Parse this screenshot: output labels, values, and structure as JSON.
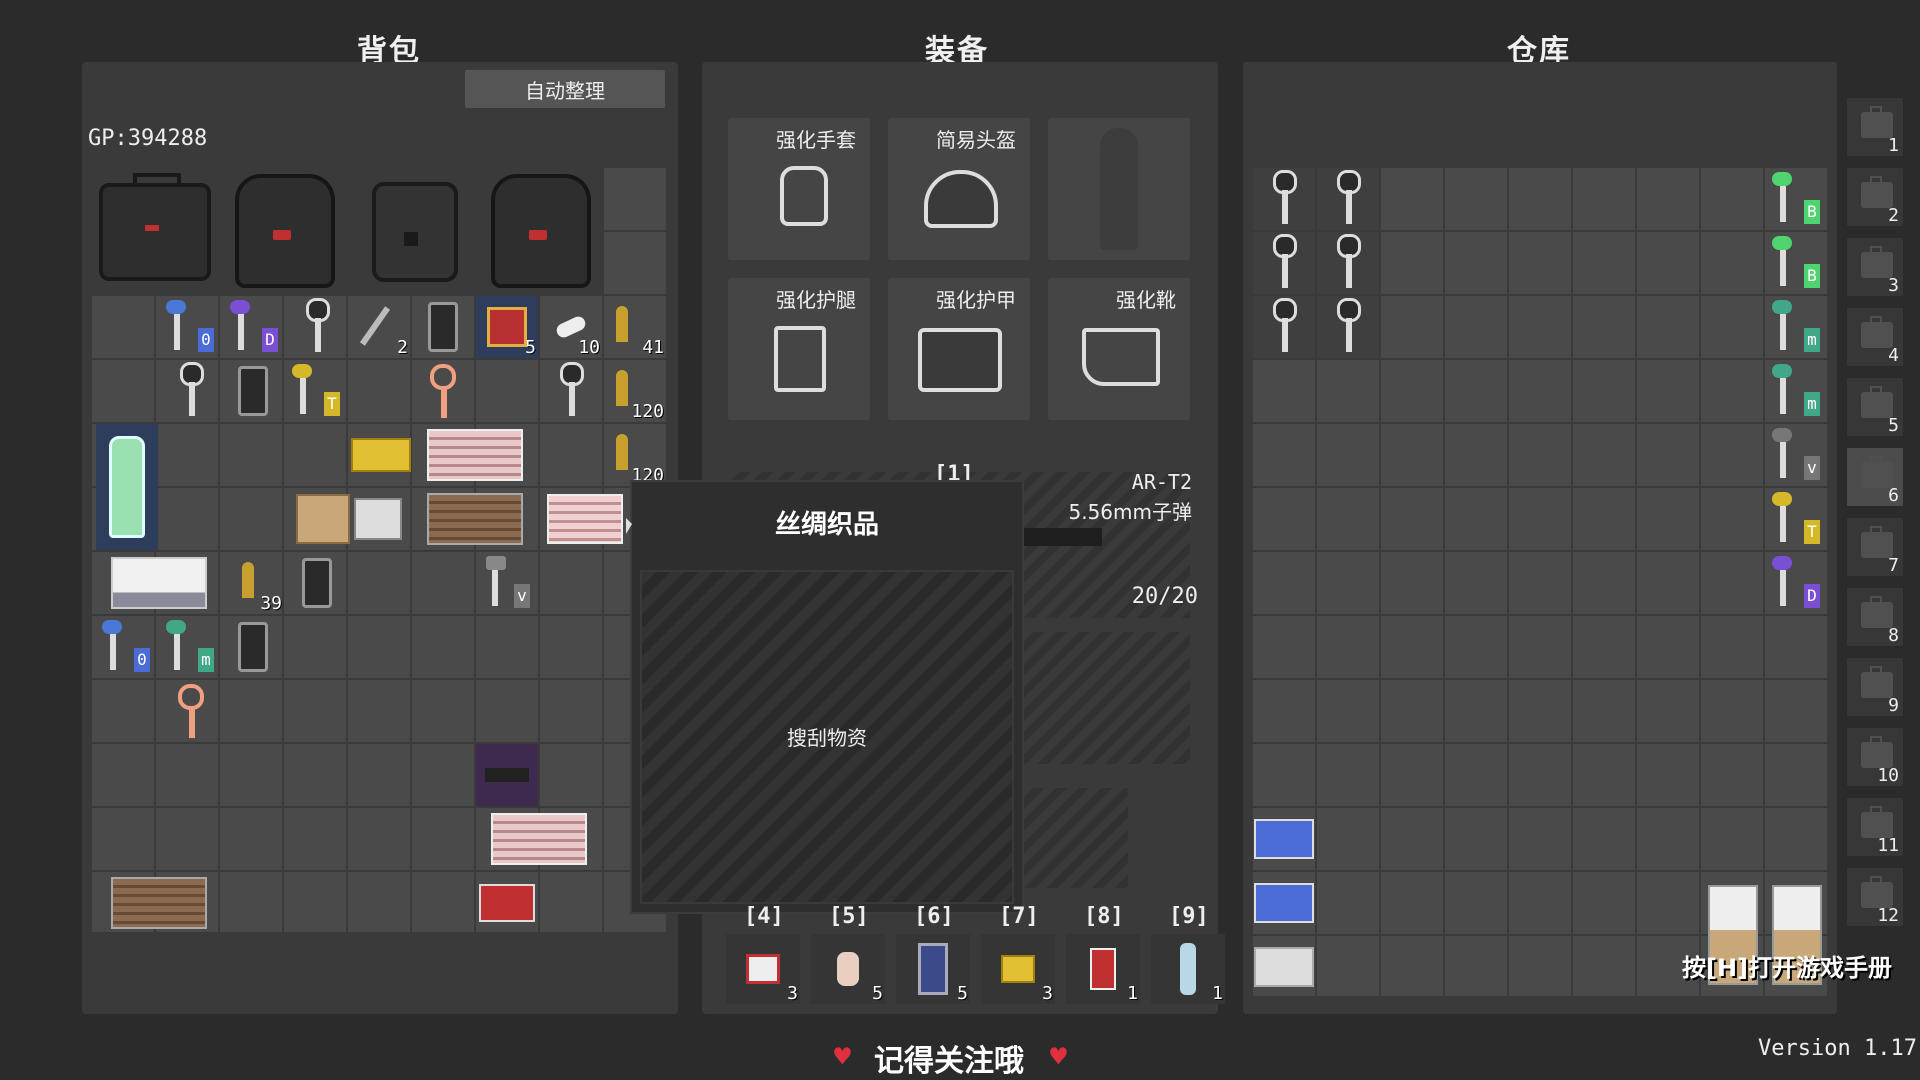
{
  "panels": {
    "backpack_title": "背包",
    "equipment_title": "装备",
    "storage_title": "仓库"
  },
  "backpack": {
    "sort_button": "自动整理",
    "gp": "GP:394288",
    "counts": [
      "2",
      "5",
      "10",
      "41",
      "120",
      "120",
      "39"
    ],
    "hotkey_tags": [
      "0",
      "D",
      "T",
      "0",
      "m",
      "v"
    ]
  },
  "equipment": {
    "slots": [
      "强化手套",
      "简易头盔",
      "",
      "强化护腿",
      "强化护甲",
      "强化靴"
    ],
    "weapon_slot_key": "[1]",
    "weapon_name": "AR-T2",
    "weapon_ammo_type": "5.56mm子弹",
    "weapon_ammo": "20/20"
  },
  "tooltip": {
    "title": "丝绸织品",
    "desc": "搜刮物资"
  },
  "hotbar": {
    "keys": [
      "[4]",
      "[5]",
      "[6]",
      "[7]",
      "[8]",
      "[9]"
    ],
    "counts": [
      "3",
      "5",
      "5",
      "3",
      "1",
      "1"
    ]
  },
  "storage": {
    "tabs": [
      "1",
      "2",
      "3",
      "4",
      "5",
      "6",
      "7",
      "8",
      "9",
      "10",
      "11",
      "12"
    ],
    "active_tab": 6,
    "tags": [
      "B",
      "B",
      "m",
      "m",
      "v",
      "T",
      "D"
    ],
    "manual_hint": "按[H]打开游戏手册"
  },
  "footer": {
    "follow": "记得关注哦",
    "version": "Version 1.17"
  },
  "colors": {
    "background": "#2b2b2b",
    "panel": "#3a3a3a",
    "cell": "#4a4a4a",
    "accent_blue": "#4a6cd4",
    "accent_purple": "#7b4fd4",
    "accent_yellow": "#d4b82a",
    "accent_green": "#4fd470"
  }
}
